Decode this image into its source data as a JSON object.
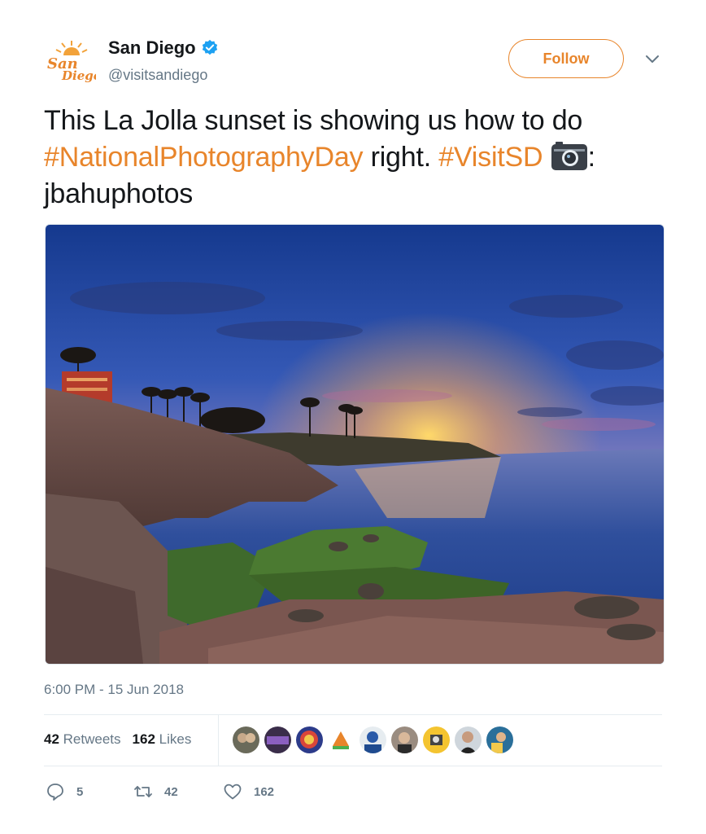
{
  "account": {
    "name": "San Diego",
    "handle": "@visitsandiego",
    "logo_text": "San Diego",
    "verified": true,
    "brand_color": "#e8852b",
    "verified_color": "#1da1f2"
  },
  "follow_label": "Follow",
  "tweet": {
    "text_part1": "This La Jolla sunset is showing us how to do ",
    "hashtag1": "#NationalPhotographyDay",
    "text_part2": " right. ",
    "hashtag2": "#VisitSD",
    "camera_icon": "camera-icon",
    "text_part3": ": jbahuphotos"
  },
  "timestamp": "6:00 PM - 15 Jun 2018",
  "stats": {
    "retweets_count": "42",
    "retweets_label": "Retweets",
    "likes_count": "162",
    "likes_label": "Likes"
  },
  "actions": {
    "reply_count": "5",
    "retweet_count": "42",
    "like_count": "162"
  },
  "facepile_icons": [
    "avatar-1",
    "avatar-2",
    "avatar-3",
    "avatar-4",
    "avatar-5",
    "avatar-6",
    "avatar-7",
    "avatar-8",
    "avatar-9"
  ]
}
